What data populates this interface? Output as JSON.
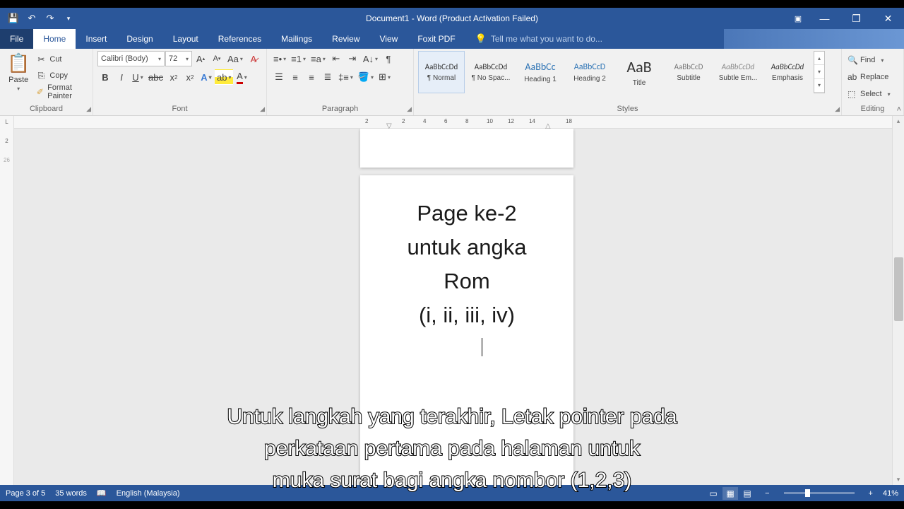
{
  "titlebar": {
    "title": "Document1 - Word (Product Activation Failed)"
  },
  "tabs": {
    "file": "File",
    "home": "Home",
    "insert": "Insert",
    "design": "Design",
    "layout": "Layout",
    "references": "References",
    "mailings": "Mailings",
    "review": "Review",
    "view": "View",
    "foxit": "Foxit PDF",
    "tellme": "Tell me what you want to do..."
  },
  "ribbon": {
    "clipboard": {
      "label": "Clipboard",
      "paste": "Paste",
      "cut": "Cut",
      "copy": "Copy",
      "painter": "Format Painter"
    },
    "font": {
      "label": "Font",
      "name": "Calibri (Body)",
      "size": "72"
    },
    "paragraph": {
      "label": "Paragraph"
    },
    "styles": {
      "label": "Styles",
      "items": [
        {
          "preview": "AaBbCcDd",
          "name": "¶ Normal"
        },
        {
          "preview": "AaBbCcDd",
          "name": "¶ No Spac..."
        },
        {
          "preview": "AaBbCc",
          "name": "Heading 1"
        },
        {
          "preview": "AaBbCcD",
          "name": "Heading 2"
        },
        {
          "preview": "AaB",
          "name": "Title"
        },
        {
          "preview": "AaBbCcD",
          "name": "Subtitle"
        },
        {
          "preview": "AaBbCcDd",
          "name": "Subtle Em..."
        },
        {
          "preview": "AaBbCcDd",
          "name": "Emphasis"
        }
      ]
    },
    "editing": {
      "label": "Editing",
      "find": "Find",
      "replace": "Replace",
      "select": "Select"
    }
  },
  "ruler": {
    "marks": [
      "2",
      "2",
      "4",
      "6",
      "8",
      "10",
      "12",
      "14",
      "18"
    ]
  },
  "document": {
    "line1": "Page ke-2",
    "line2": "untuk angka",
    "line3": "Rom",
    "line4": "(i, ii, iii, iv)"
  },
  "status": {
    "page": "Page 3 of 5",
    "words": "35 words",
    "lang": "English (Malaysia)",
    "zoom": "41%"
  },
  "subtitle": "Untuk langkah yang terakhir, Letak pointer pada\nperkataan pertama pada halaman untuk\nmuka surat bagi angka nombor (1,2,3)"
}
